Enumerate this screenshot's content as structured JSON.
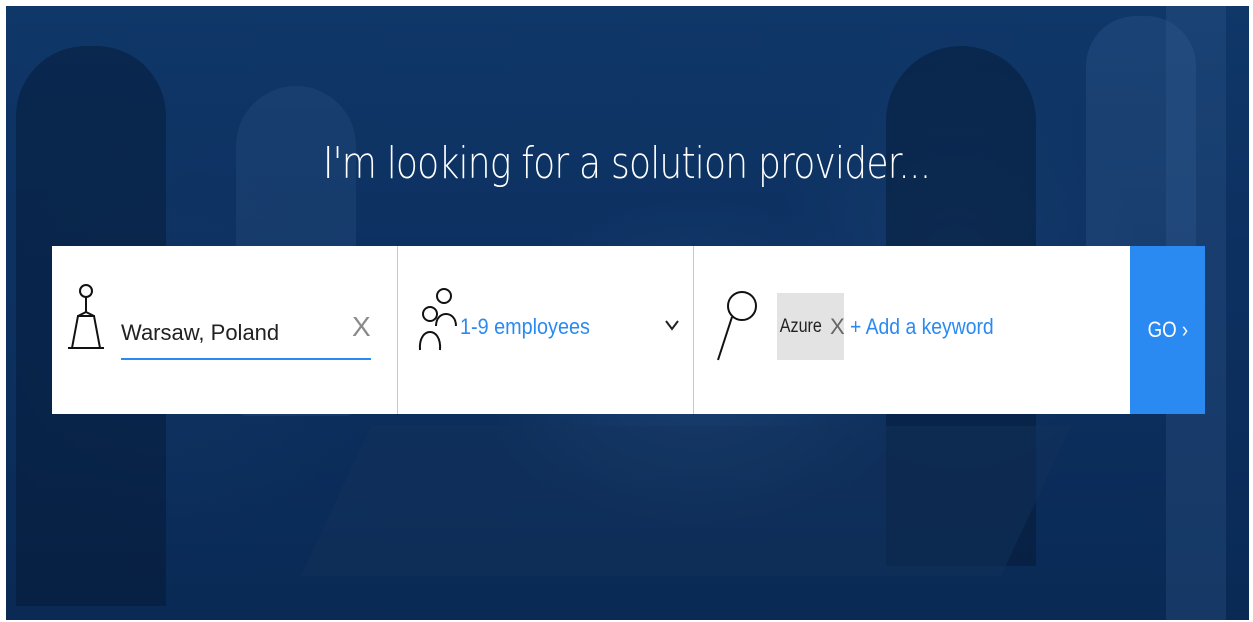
{
  "hero": {
    "title": "I'm looking for a solution provider..."
  },
  "search": {
    "location": {
      "value": "Warsaw, Poland",
      "clear_glyph": "X",
      "icon": "location-pin-icon"
    },
    "company_size": {
      "selected": "1-9 employees",
      "icon": "people-icon"
    },
    "keywords": {
      "tags": [
        "Azure"
      ],
      "tag_remove_glyph": "X",
      "add_label": "+ Add a keyword",
      "icon": "search-icon"
    },
    "go_label": "GO ›"
  },
  "colors": {
    "accent": "#2a8af2",
    "background": "#0c3060",
    "tag_bg": "#e3e3e3"
  }
}
